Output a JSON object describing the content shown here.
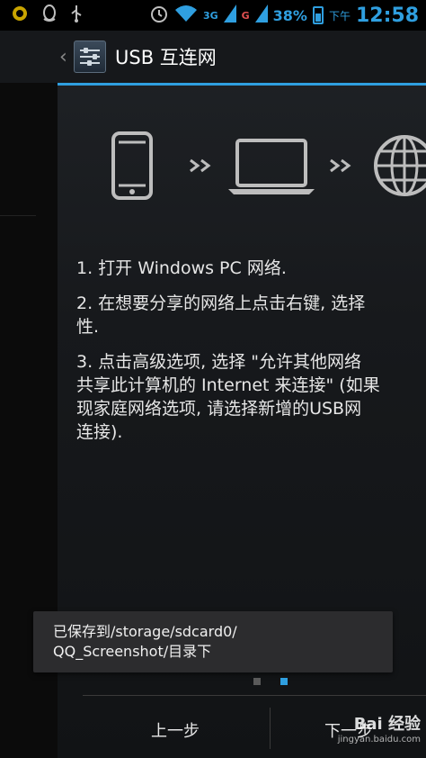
{
  "status_bar": {
    "icons": [
      "android-debug-icon",
      "qq-icon",
      "usb-icon",
      "alarm-icon",
      "wifi-icon",
      "signal-3g-icon",
      "signal-g-icon"
    ],
    "network_3g": "3G",
    "network_g": "G",
    "battery_percent": "38%",
    "ampm": "下午",
    "time": "12:58",
    "accent_color": "#2f9fe0"
  },
  "action_bar": {
    "up_caret": "‹",
    "title": "USB 互连网"
  },
  "illustration": {
    "icons": [
      "phone-icon",
      "laptop-icon",
      "globe-icon"
    ],
    "arrows": "››"
  },
  "instructions": [
    [
      "1. 打开 Windows PC 网络."
    ],
    [
      "2. 在想要分享的网络上点击右键, 选择",
      "性."
    ],
    [
      "3. 点击高级选项, 选择 \"允许其他网络",
      "共享此计算机的 Internet 来连接\" (如果",
      "现家庭网络选项, 请选择新增的USB网",
      "连接)."
    ]
  ],
  "toast": {
    "line1": "已保存到/storage/sdcard0/",
    "line2": "QQ_Screenshot/目录下"
  },
  "pager": {
    "pages": 2,
    "current": 2
  },
  "buttons": {
    "prev": "上一步",
    "next": "下一步"
  },
  "watermark": {
    "text": "Bai 经验",
    "url": "jingyan.baidu.com"
  }
}
